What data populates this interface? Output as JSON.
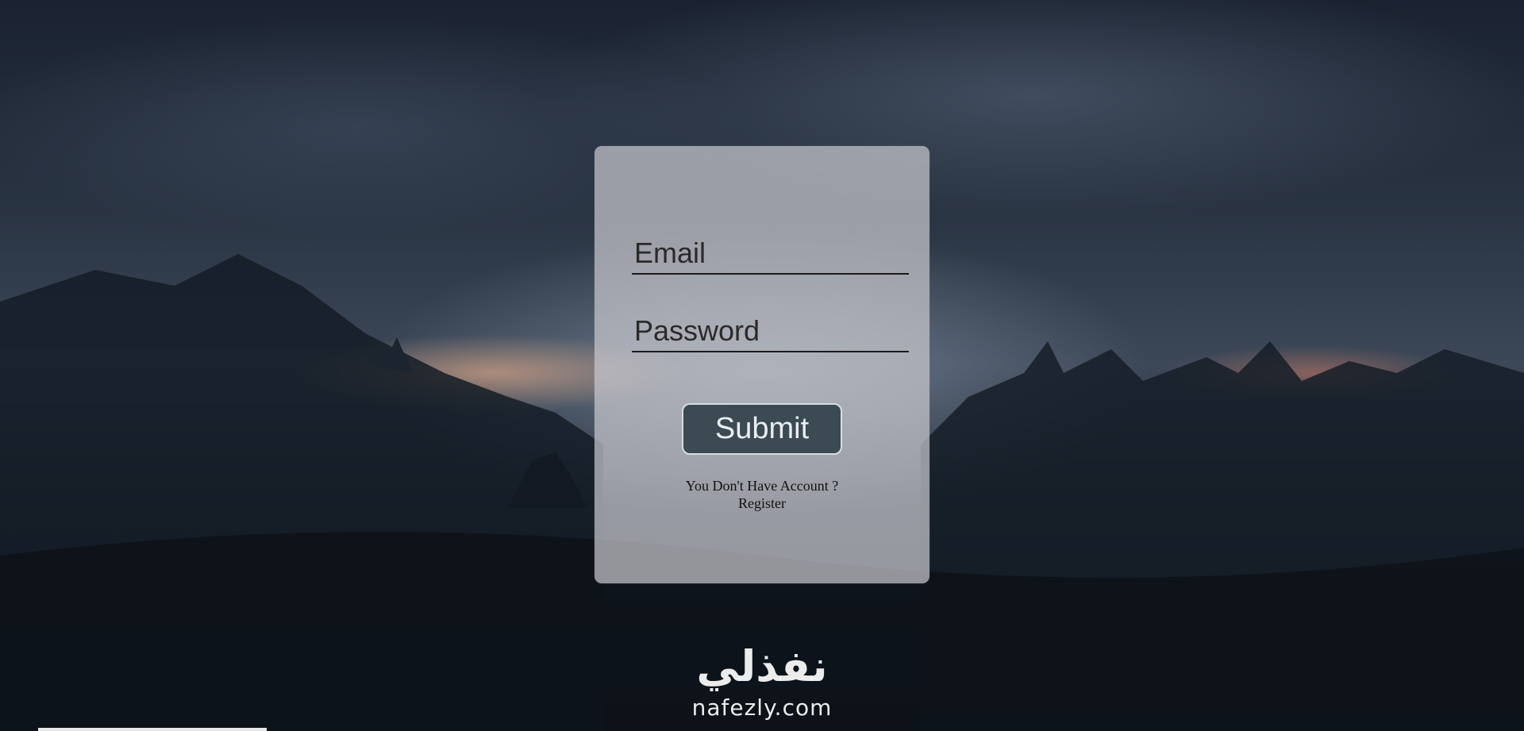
{
  "form": {
    "email_placeholder": "Email",
    "password_placeholder": "Password",
    "submit_label": "Submit",
    "account_prompt": "You Don't Have Account ?",
    "register_label": "Register"
  },
  "watermark": {
    "arabic_text": "نفذلي",
    "latin_text": "nafezly.com"
  },
  "colors": {
    "card_background": "#c8c8cd",
    "submit_background": "#3c4a54",
    "submit_text": "#e9eef2",
    "field_underline": "#1b1b1b"
  }
}
